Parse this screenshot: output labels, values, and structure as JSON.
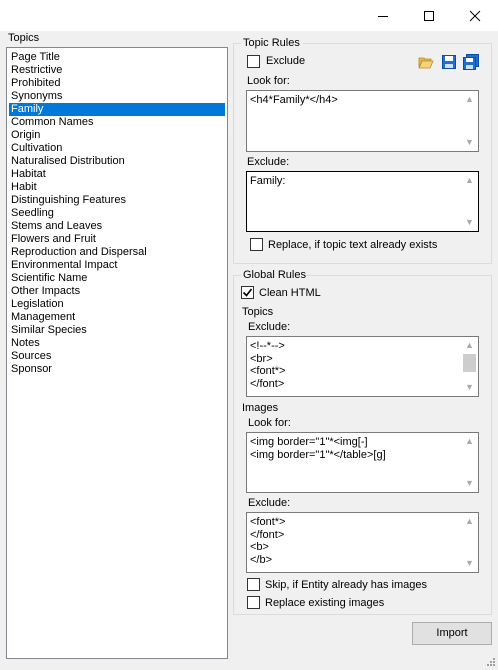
{
  "window": {
    "min_icon": "minimize-icon",
    "max_icon": "maximize-icon",
    "close_icon": "close-icon"
  },
  "topics": {
    "label": "Topics",
    "items": [
      "Page Title",
      "Restrictive",
      "Prohibited",
      "Synonyms",
      "Family",
      "Common Names",
      "Origin",
      "Cultivation",
      "Naturalised Distribution",
      "Habitat",
      "Habit",
      "Distinguishing Features",
      "Seedling",
      "Stems and Leaves",
      "Flowers and Fruit",
      "Reproduction and Dispersal",
      "Environmental Impact",
      "Scientific Name",
      "Other Impacts",
      "Legislation",
      "Management",
      "Similar Species",
      "Notes",
      "Sources",
      "Sponsor"
    ],
    "selected": "Family"
  },
  "topic_rules": {
    "title": "Topic Rules",
    "exclude_label": "Exclude",
    "exclude_checked": false,
    "icons": [
      "open-folder-icon",
      "save-icon",
      "save-all-icon"
    ],
    "look_for_label": "Look for:",
    "look_for_text": "<h4*Family*</h4>",
    "exclude_field_label": "Exclude:",
    "exclude_text": "Family:",
    "replace_label": "Replace, if topic text already exists",
    "replace_checked": false
  },
  "global_rules": {
    "title": "Global Rules",
    "clean_html_label": "Clean HTML",
    "clean_html_checked": true,
    "topics_label": "Topics",
    "topics_exclude_label": "Exclude:",
    "topics_exclude_lines": [
      "<!--*-->",
      "<br>",
      "<font*>",
      "</font>"
    ],
    "images_label": "Images",
    "images_look_for_label": "Look for:",
    "images_look_for_lines": [
      "<img border=\"1\"*<img[-]",
      "<img border=\"1\"*</table>[g]"
    ],
    "images_exclude_label": "Exclude:",
    "images_exclude_lines": [
      "<font*>",
      "</font>",
      "<b>",
      "</b>"
    ],
    "skip_label": "Skip, if Entity already has images",
    "skip_checked": false,
    "replace_images_label": "Replace existing images",
    "replace_images_checked": false
  },
  "import_button": "Import"
}
